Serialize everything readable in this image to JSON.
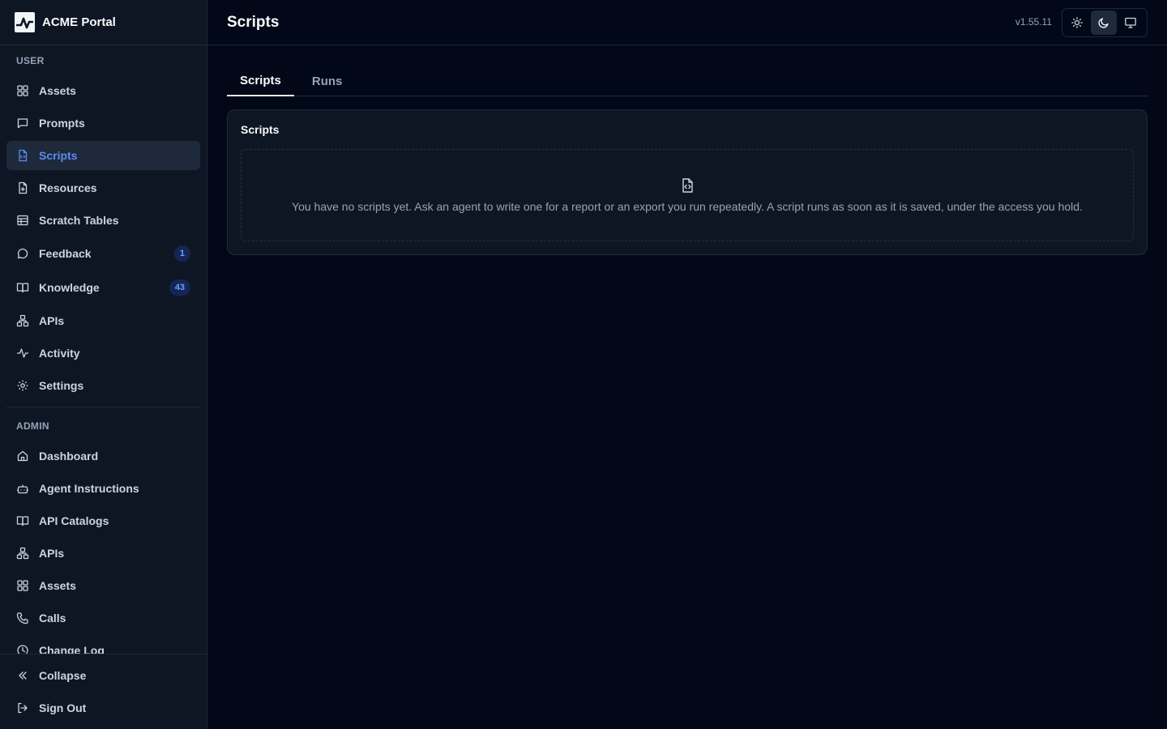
{
  "brand": {
    "name": "ACME Portal"
  },
  "header": {
    "title": "Scripts",
    "version": "v1.55.11"
  },
  "sidebar": {
    "user_label": "USER",
    "user_items": [
      {
        "label": "Assets",
        "icon": "grid-icon"
      },
      {
        "label": "Prompts",
        "icon": "message-square-icon"
      },
      {
        "label": "Scripts",
        "icon": "file-code-icon",
        "active": true
      },
      {
        "label": "Resources",
        "icon": "file-plus-icon"
      },
      {
        "label": "Scratch Tables",
        "icon": "table-icon"
      },
      {
        "label": "Feedback",
        "icon": "message-circle-icon",
        "badge": "1"
      },
      {
        "label": "Knowledge",
        "icon": "book-open-icon",
        "badge": "43"
      },
      {
        "label": "APIs",
        "icon": "network-icon"
      },
      {
        "label": "Activity",
        "icon": "activity-icon"
      },
      {
        "label": "Settings",
        "icon": "gear-icon"
      }
    ],
    "admin_label": "ADMIN",
    "admin_items": [
      {
        "label": "Dashboard",
        "icon": "home-icon"
      },
      {
        "label": "Agent Instructions",
        "icon": "bot-icon"
      },
      {
        "label": "API Catalogs",
        "icon": "book-open-icon"
      },
      {
        "label": "APIs",
        "icon": "network-icon"
      },
      {
        "label": "Assets",
        "icon": "grid-icon"
      },
      {
        "label": "Calls",
        "icon": "phone-icon"
      },
      {
        "label": "Change Log",
        "icon": "clock-icon"
      }
    ],
    "footer": {
      "collapse": "Collapse",
      "sign_out": "Sign Out"
    }
  },
  "tabs": [
    {
      "label": "Scripts",
      "active": true
    },
    {
      "label": "Runs",
      "active": false
    }
  ],
  "card": {
    "title": "Scripts",
    "empty_text": "You have no scripts yet. Ask an agent to write one for a report or an export you run repeatedly. A script runs as soon as it is saved, under the access you hold."
  },
  "colors": {
    "background": "#020817",
    "sidebar": "#0f1623",
    "accent": "#5b8def",
    "badge_bg": "#172554",
    "badge_text": "#60a5fa"
  }
}
